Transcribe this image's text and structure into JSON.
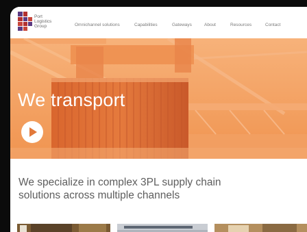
{
  "logo": {
    "line1": "Port",
    "line2": "Logistics",
    "line3": "Group"
  },
  "nav": {
    "items": [
      "Omnichannel solutions",
      "Capabilities",
      "Gateways",
      "About",
      "Resources",
      "Contact"
    ]
  },
  "hero": {
    "title": "We transport",
    "overlay_color": "#f29a57"
  },
  "intro": {
    "text": "We specialize in complex 3PL supply chain solutions across multiple channels"
  },
  "colors": {
    "brand_orange": "#e2793b",
    "logo_red": "#b3312f",
    "logo_purple": "#4a2c6d"
  }
}
